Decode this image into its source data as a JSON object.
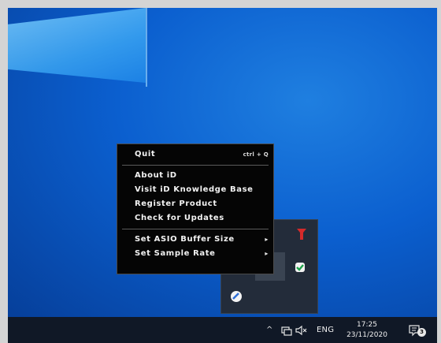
{
  "context_menu": {
    "items": [
      {
        "label": "Quit",
        "shortcut": "ctrl + Q"
      },
      {
        "label": "About iD"
      },
      {
        "label": "Visit iD Knowledge Base"
      },
      {
        "label": "Register Product"
      },
      {
        "label": "Check for Updates"
      },
      {
        "label": "Set ASIO Buffer Size",
        "submenu_arrow": "▸"
      },
      {
        "label": "Set Sample Rate",
        "submenu_arrow": "▸"
      }
    ]
  },
  "tray_overflow": {
    "icons": [
      "red-app-icon",
      "green-app-icon",
      "blue-app-icon"
    ]
  },
  "taskbar": {
    "chevron": "^",
    "language": "ENG",
    "time": "17:25",
    "date": "23/11/2020",
    "notification_count": "3",
    "icons": [
      "network-icon",
      "volume-muted-icon",
      "notification-icon"
    ]
  },
  "colors": {
    "desktop_blue": "#0b5fcf",
    "menu_bg": "#050505",
    "taskbar_bg": "#101826",
    "tray_overflow_bg": "#232c3a"
  }
}
